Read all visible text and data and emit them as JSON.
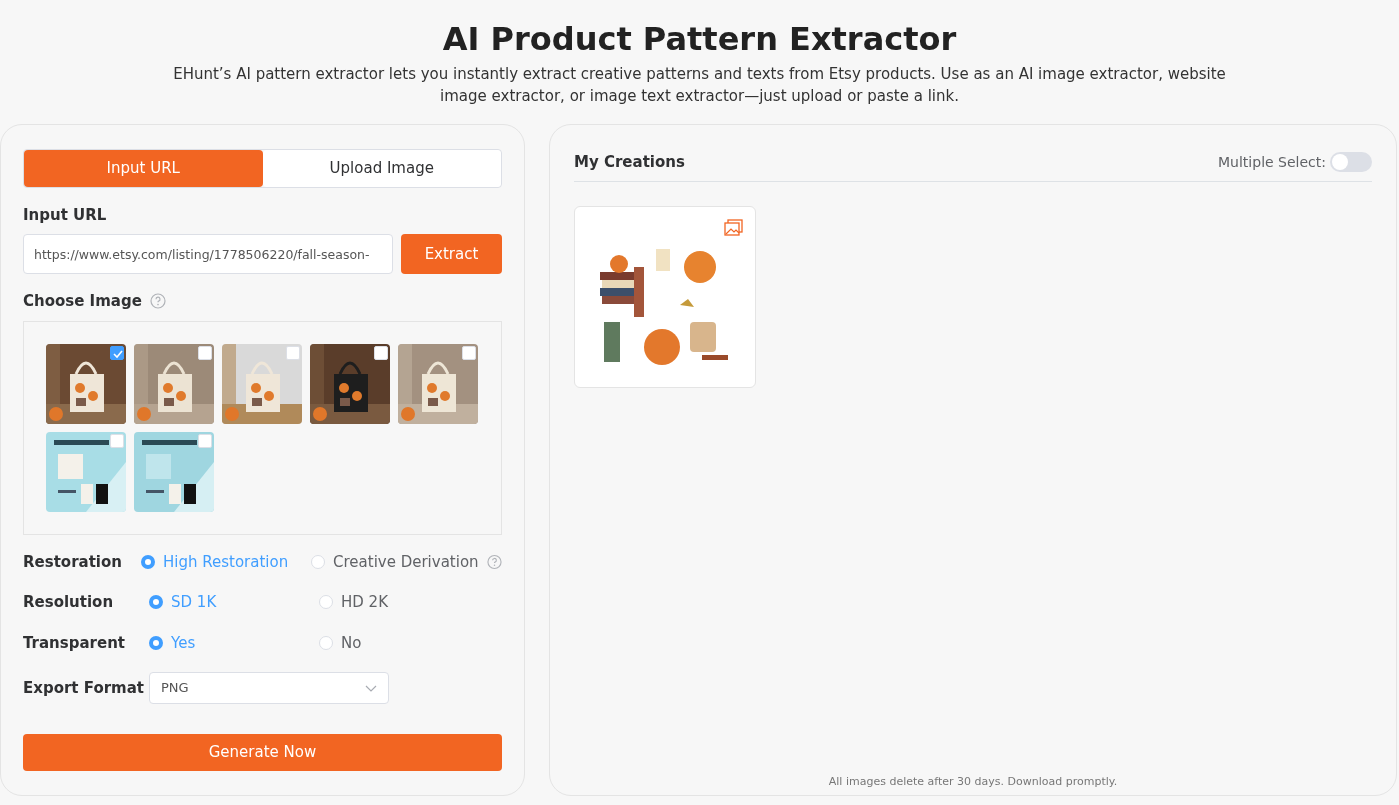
{
  "header": {
    "title": "AI Product Pattern Extractor",
    "subtitle": "EHunt’s AI pattern extractor lets you instantly extract creative patterns and texts from Etsy products. Use as an AI image extractor, website image extractor, or image text extractor—just upload or paste a link."
  },
  "tabs": [
    {
      "label": "Input URL",
      "selected": true
    },
    {
      "label": "Upload Image",
      "selected": false
    }
  ],
  "url_section": {
    "label": "Input URL",
    "value": "https://www.etsy.com/listing/1778506220/fall-season-",
    "button": "Extract"
  },
  "choose_image": {
    "label": "Choose Image",
    "help": true,
    "images": [
      {
        "kind": "picture",
        "selected": true
      },
      {
        "kind": "picture",
        "selected": false
      },
      {
        "kind": "picture",
        "selected": false
      },
      {
        "kind": "picture",
        "selected": false
      },
      {
        "kind": "picture",
        "selected": false
      },
      {
        "kind": "picture",
        "selected": false
      },
      {
        "kind": "picture",
        "selected": false
      }
    ]
  },
  "options": [
    {
      "label": "Restoration",
      "help": true,
      "choices": [
        {
          "label": "High Restoration",
          "selected": true
        },
        {
          "label": "Creative Derivation",
          "selected": false
        }
      ]
    },
    {
      "label": "Resolution",
      "help": false,
      "choices": [
        {
          "label": "SD 1K",
          "selected": true
        },
        {
          "label": "HD 2K",
          "selected": false
        }
      ]
    },
    {
      "label": "Transparent",
      "help": false,
      "choices": [
        {
          "label": "Yes",
          "selected": true
        },
        {
          "label": "No",
          "selected": false
        }
      ]
    }
  ],
  "export_format": {
    "label": "Export Format",
    "value": "PNG"
  },
  "generate_button": "Generate Now",
  "creations": {
    "title": "My Creations",
    "multiple_select": {
      "label": "Multiple Select:",
      "on": false
    },
    "items": [
      {
        "kind": "picture"
      }
    ],
    "footer": "All images delete after 30 days. Download promptly."
  }
}
